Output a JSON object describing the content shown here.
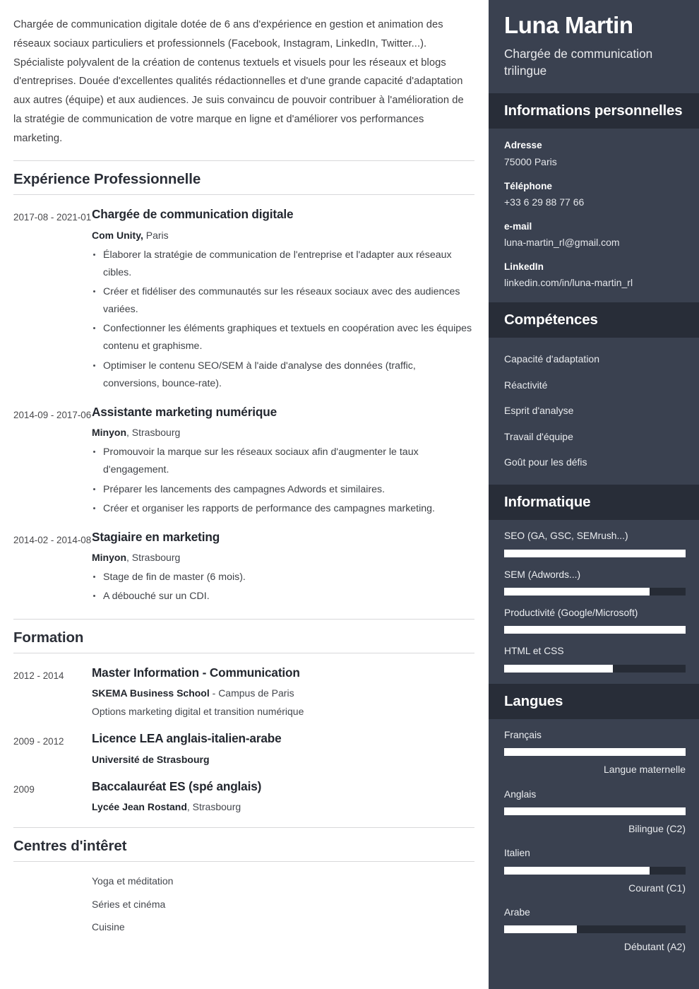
{
  "summary": "Chargée de communication digitale dotée de 6 ans d'expérience en gestion et animation des réseaux sociaux particuliers et professionnels (Facebook, Instagram, LinkedIn, Twitter...). Spécialiste polyvalent de la création de contenus textuels et visuels pour les réseaux et blogs d'entreprises. Douée d'excellentes qualités rédactionnelles et d'une grande capacité d'adaptation aux autres (équipe) et aux audiences. Je suis convaincu de pouvoir contribuer à l'amélioration de la stratégie de communication de votre marque en ligne et d'améliorer vos performances marketing.",
  "sections": {
    "experience_title": "Expérience Professionnelle",
    "formation_title": "Formation",
    "interests_title": "Centres d'intêret"
  },
  "experience": [
    {
      "date": "2017-08 - 2021-01",
      "role": "Chargée de communication digitale",
      "org_bold": "Com Unity,",
      "org_rest": " Paris",
      "bullets": [
        "Élaborer la stratégie de communication de l'entreprise et l'adapter aux réseaux cibles.",
        "Créer et fidéliser des communautés sur les réseaux sociaux avec des audiences variées.",
        "Confectionner les éléments graphiques et textuels en coopération avec les équipes contenu et graphisme.",
        "Optimiser le contenu SEO/SEM à l'aide d'analyse des données (traffic, conversions, bounce-rate)."
      ]
    },
    {
      "date": "2014-09 - 2017-06",
      "role": "Assistante marketing numérique",
      "org_bold": "Minyon",
      "org_rest": ", Strasbourg",
      "bullets": [
        "Promouvoir la marque sur les réseaux sociaux afin d'augmenter le taux d'engagement.",
        "Préparer les lancements des campagnes Adwords et similaires.",
        "Créer et organiser les rapports de performance des campagnes marketing."
      ]
    },
    {
      "date": "2014-02 - 2014-08",
      "role": "Stagiaire en marketing",
      "org_bold": "Minyon",
      "org_rest": ", Strasbourg",
      "bullets": [
        "Stage de fin de master (6 mois).",
        "A débouché sur un CDI."
      ]
    }
  ],
  "formation": [
    {
      "date": "2012 - 2014",
      "role": "Master Information - Communication",
      "org_bold": "SKEMA Business School",
      "org_rest": " - Campus de Paris",
      "extra": "Options marketing digital et transition numérique"
    },
    {
      "date": "2009 - 2012",
      "role": "Licence LEA anglais-italien-arabe",
      "org_bold": "Université de Strasbourg",
      "org_rest": "",
      "extra": ""
    },
    {
      "date": "2009",
      "role": "Baccalauréat ES (spé anglais)",
      "org_bold": "Lycée Jean Rostand",
      "org_rest": ", Strasbourg",
      "extra": ""
    }
  ],
  "interests": [
    "Yoga et méditation",
    "Séries et cinéma",
    "Cuisine"
  ],
  "sidebar": {
    "name": "Luna Martin",
    "job_title": "Chargée de communication trilingue",
    "personal_info_title": "Informations personnelles",
    "contact": [
      {
        "label": "Adresse",
        "value": "75000 Paris"
      },
      {
        "label": "Téléphone",
        "value": "+33 6 29 88 77 66"
      },
      {
        "label": "e-mail",
        "value": "luna-martin_rl@gmail.com"
      },
      {
        "label": "LinkedIn",
        "value": "linkedin.com/in/luna-martin_rl"
      }
    ],
    "skills_title": "Compétences",
    "skills": [
      "Capacité d'adaptation",
      "Réactivité",
      "Esprit d'analyse",
      "Travail d'équipe",
      "Goût pour les défis"
    ],
    "it_title": "Informatique",
    "it_skills": [
      {
        "label": "SEO (GA, GSC, SEMrush...)",
        "level": 100
      },
      {
        "label": "SEM (Adwords...)",
        "level": 80
      },
      {
        "label": "Productivité (Google/Microsoft)",
        "level": 100
      },
      {
        "label": "HTML et CSS",
        "level": 60
      }
    ],
    "languages_title": "Langues",
    "languages": [
      {
        "label": "Français",
        "level": 100,
        "caption": "Langue maternelle"
      },
      {
        "label": "Anglais",
        "level": 100,
        "caption": "Bilingue (C2)"
      },
      {
        "label": "Italien",
        "level": 80,
        "caption": "Courant (C1)"
      },
      {
        "label": "Arabe",
        "level": 40,
        "caption": "Débutant (A2)"
      }
    ]
  },
  "colors": {
    "sidebar_bg": "#3a4150",
    "sidebar_header_bg": "#282d38",
    "bar_fill": "#ffffff",
    "bar_track": "#262b35"
  }
}
